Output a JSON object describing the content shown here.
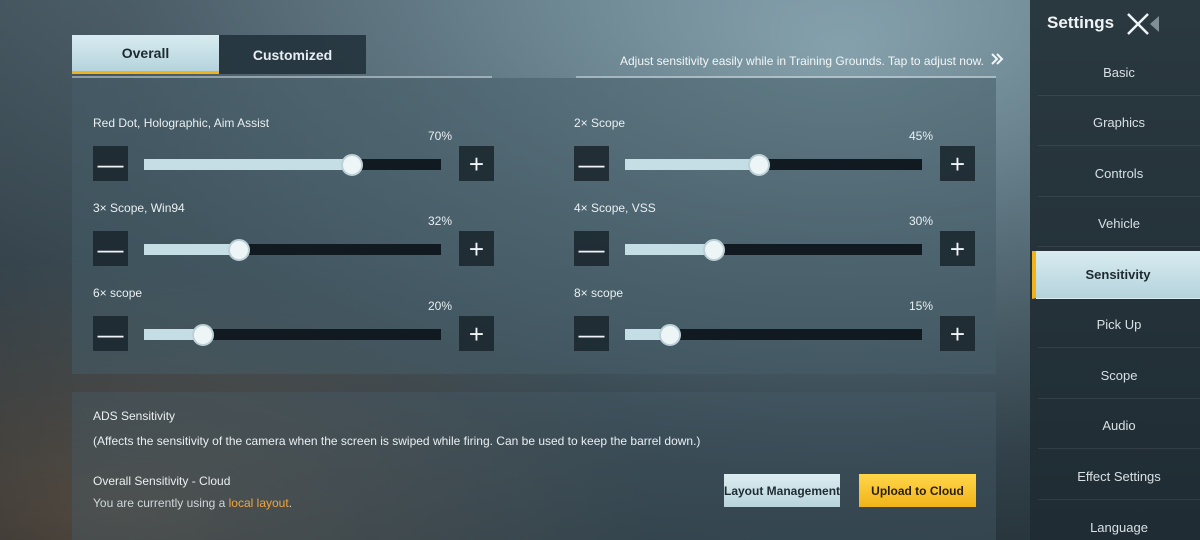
{
  "tabs": [
    {
      "label": "Overall",
      "active": true
    },
    {
      "label": "Customized",
      "active": false
    }
  ],
  "hint": {
    "text": "Adjust sensitivity easily while in Training Grounds. Tap to adjust now.",
    "icon": "double-chevron-right-icon"
  },
  "sliders": [
    {
      "label": "Red Dot, Holographic, Aim Assist",
      "percent_text": "70%",
      "value": 70
    },
    {
      "label": "2× Scope",
      "percent_text": "45%",
      "value": 45
    },
    {
      "label": "3× Scope, Win94",
      "percent_text": "32%",
      "value": 32
    },
    {
      "label": "4× Scope, VSS",
      "percent_text": "30%",
      "value": 30
    },
    {
      "label": "6× scope",
      "percent_text": "20%",
      "value": 20
    },
    {
      "label": "8× scope",
      "percent_text": "15%",
      "value": 15
    }
  ],
  "stepper": {
    "minus": "—",
    "plus": "+"
  },
  "ads": {
    "title": "ADS Sensitivity",
    "description": "(Affects the sensitivity of the camera when the screen is swiped while firing. Can be used to keep the barrel down.)"
  },
  "cloud": {
    "title": "Overall Sensitivity - Cloud",
    "desc_prefix": "You are currently using a ",
    "desc_link": "local layout",
    "desc_suffix": "."
  },
  "buttons": {
    "layout_management": "Layout Management",
    "upload_to_cloud": "Upload to Cloud"
  },
  "sidebar": {
    "title": "Settings",
    "items": [
      {
        "label": "Basic",
        "active": false
      },
      {
        "label": "Graphics",
        "active": false
      },
      {
        "label": "Controls",
        "active": false
      },
      {
        "label": "Vehicle",
        "active": false
      },
      {
        "label": "Sensitivity",
        "active": true
      },
      {
        "label": "Pick Up",
        "active": false
      },
      {
        "label": "Scope",
        "active": false
      },
      {
        "label": "Audio",
        "active": false
      },
      {
        "label": "Effect Settings",
        "active": false
      },
      {
        "label": "Language",
        "active": false
      }
    ]
  },
  "colors": {
    "accent": "#f2b319",
    "active_tab": "#c7e0e7",
    "link": "#f1a43c"
  }
}
